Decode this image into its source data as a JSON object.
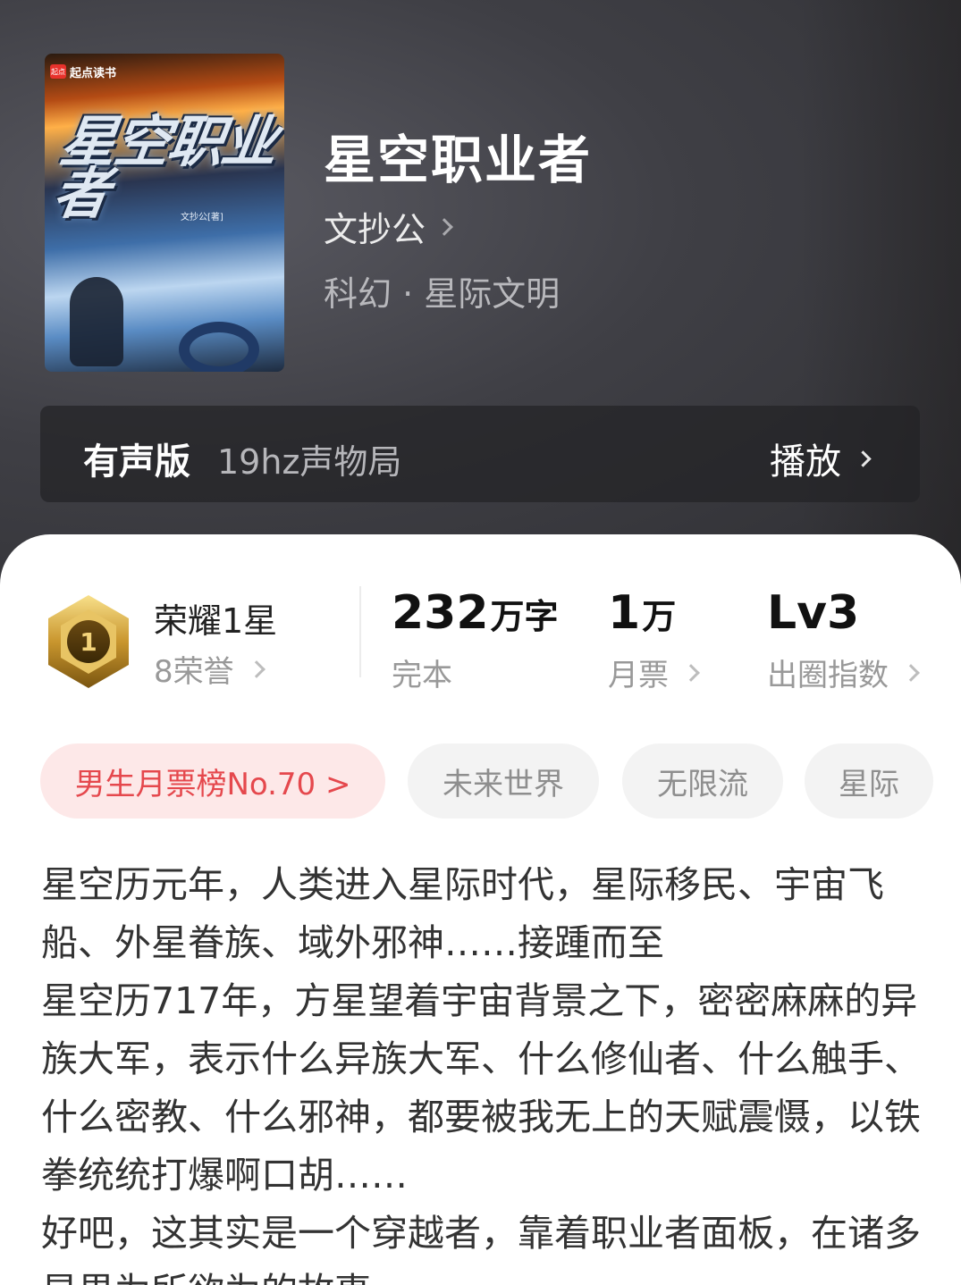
{
  "book": {
    "title": "星空职业者",
    "author": "文抄公",
    "genre": "科幻 · 星际文明",
    "cover": {
      "brand_badge": "起点",
      "brand": "起点读书",
      "title": "星空职业者",
      "author_line": "文抄公[著]"
    }
  },
  "audio": {
    "label": "有声版",
    "narrator": "19hz声物局",
    "play_label": "播放"
  },
  "stats": {
    "honor": {
      "title": "荣耀1星",
      "sub": "8荣誉",
      "medal_number": "1"
    },
    "words": {
      "value": "232",
      "unit": "万字",
      "label": "完本"
    },
    "tickets": {
      "value": "1",
      "unit": "万",
      "label": "月票"
    },
    "index": {
      "value": "Lv3",
      "label": "出圈指数"
    }
  },
  "tags": [
    {
      "label": "男生月票榜No.70 >"
    },
    {
      "label": "未来世界"
    },
    {
      "label": "无限流"
    },
    {
      "label": "星际"
    }
  ],
  "description": "星空历元年，人类进入星际时代，星际移民、宇宙飞船、外星眷族、域外邪神……接踵而至\n星空历717年，方星望着宇宙背景之下，密密麻麻的异族大军，表示什么异族大军、什么修仙者、什么触手、什么密教、什么邪神，都要被我无上的天赋震慑，以铁拳统统打爆啊口胡……\n好吧，这其实是一个穿越者，靠着职业者面板，在诸多星界为所欲为的故事。",
  "colors": {
    "accent_red": "#e5484d",
    "rank_tag_bg": "#fde8e8",
    "hero_bg": "#3f3f45"
  }
}
